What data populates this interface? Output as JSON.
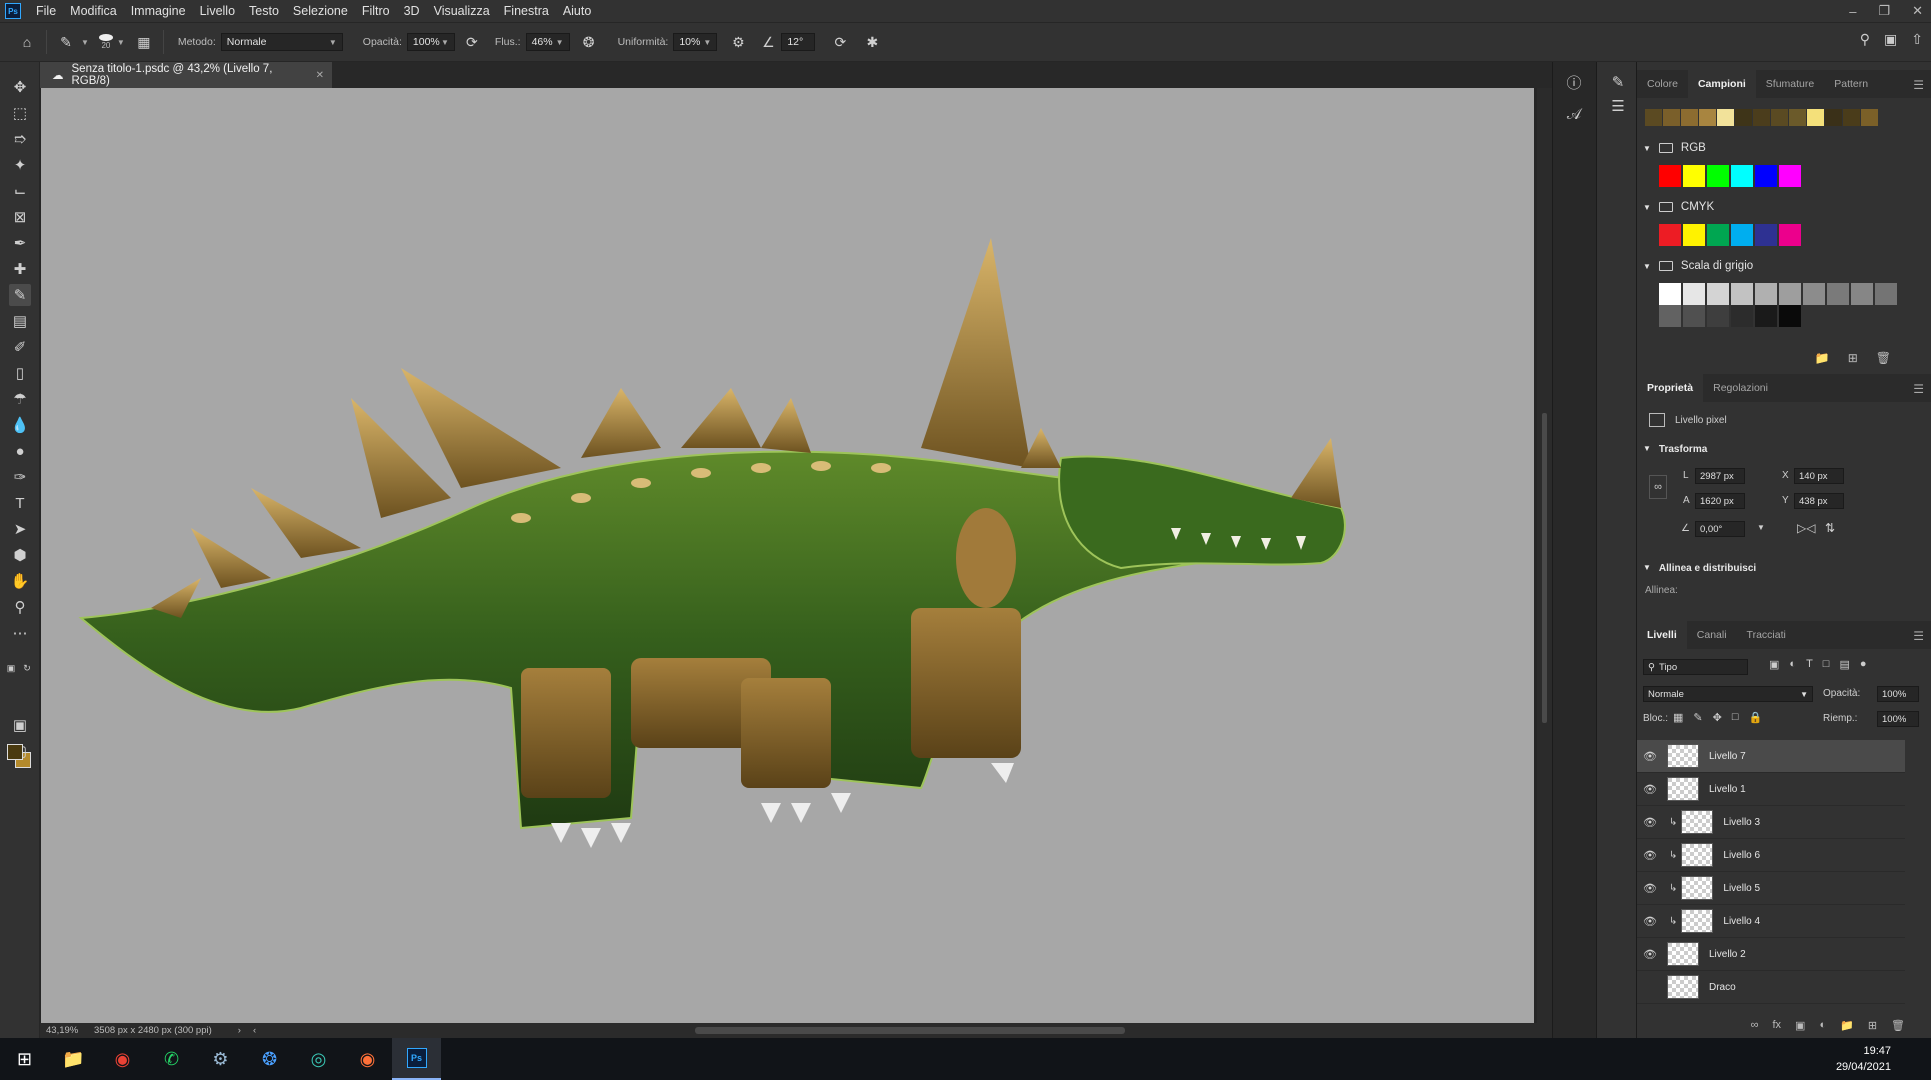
{
  "menu": {
    "logo": "Ps",
    "items": [
      "File",
      "Modifica",
      "Immagine",
      "Livello",
      "Testo",
      "Selezione",
      "Filtro",
      "3D",
      "Visualizza",
      "Finestra",
      "Aiuto"
    ]
  },
  "options": {
    "brush_size": "20",
    "mode_label": "Metodo:",
    "mode_value": "Normale",
    "opacity_label": "Opacità:",
    "opacity_value": "100%",
    "flow_label": "Flus.:",
    "flow_value": "46%",
    "smoothing_label": "Uniformità:",
    "smoothing_value": "10%",
    "angle_value": "12°"
  },
  "document": {
    "tab_title": "Senza titolo-1.psdc @ 43,2% (Livello 7, RGB/8)",
    "zoom": "43,19%",
    "size_info": "3508 px x 2480 px (300 ppi)"
  },
  "swatches_panel": {
    "tabs": [
      "Colore",
      "Campioni",
      "Sfumature",
      "Pattern"
    ],
    "active_tab": "Campioni",
    "recent": [
      "#5b4a22",
      "#7a5f2a",
      "#8c6c30",
      "#a88540",
      "#f2e29a",
      "#3e3418",
      "#4b3d1c",
      "#5a4a22",
      "#6b5a2a",
      "#f4e07a",
      "#3a3018",
      "#4a3c1a",
      "#7b6028"
    ],
    "groups": [
      {
        "name": "RGB",
        "colors": [
          "#ff0000",
          "#ffff00",
          "#00ff00",
          "#00ffff",
          "#0000ff",
          "#ff00ff"
        ]
      },
      {
        "name": "CMYK",
        "colors": [
          "#ed1c24",
          "#fff200",
          "#00a651",
          "#00aeef",
          "#2e3192",
          "#ec008c"
        ]
      },
      {
        "name": "Scala di grigio",
        "colors": [
          "#ffffff",
          "#e6e6e6",
          "#d4d4d4",
          "#c2c2c2",
          "#b0b0b0",
          "#9e9e9e",
          "#8c8c8c",
          "#7a7a7a",
          "#868686",
          "#747474",
          "#626262",
          "#505050",
          "#3e3e3e",
          "#2c2c2c",
          "#1a1a1a",
          "#0a0a0a"
        ]
      }
    ]
  },
  "properties": {
    "tabs": [
      "Proprietà",
      "Regolazioni"
    ],
    "active_tab": "Proprietà",
    "kind": "Livello pixel",
    "transform_label": "Trasforma",
    "w_label": "L",
    "w_value": "2987 px",
    "h_label": "A",
    "h_value": "1620 px",
    "x_label": "X",
    "x_value": "140 px",
    "y_label": "Y",
    "y_value": "438 px",
    "angle_value": "0,00°",
    "align_label": "Allinea e distribuisci",
    "align_sub": "Allinea:"
  },
  "layers_panel": {
    "tabs": [
      "Livelli",
      "Canali",
      "Tracciati"
    ],
    "active_tab": "Livelli",
    "filter": "Tipo",
    "blend": "Normale",
    "opacity_label": "Opacità:",
    "opacity_value": "100%",
    "lock_label": "Bloc.:",
    "fill_label": "Riemp.:",
    "fill_value": "100%",
    "layers": [
      {
        "name": "Livello 7",
        "visible": true,
        "clipped": false,
        "selected": true
      },
      {
        "name": "Livello 1",
        "visible": true,
        "clipped": false,
        "selected": false
      },
      {
        "name": "Livello 3",
        "visible": true,
        "clipped": true,
        "selected": false
      },
      {
        "name": "Livello 6",
        "visible": true,
        "clipped": true,
        "selected": false
      },
      {
        "name": "Livello 5",
        "visible": true,
        "clipped": true,
        "selected": false
      },
      {
        "name": "Livello 4",
        "visible": true,
        "clipped": true,
        "selected": false
      },
      {
        "name": "Livello 2",
        "visible": true,
        "clipped": false,
        "selected": false
      },
      {
        "name": "Draco",
        "visible": false,
        "clipped": false,
        "selected": false
      }
    ]
  },
  "taskbar": {
    "time": "19:47",
    "date": "29/04/2021",
    "active_app": "Ps"
  }
}
